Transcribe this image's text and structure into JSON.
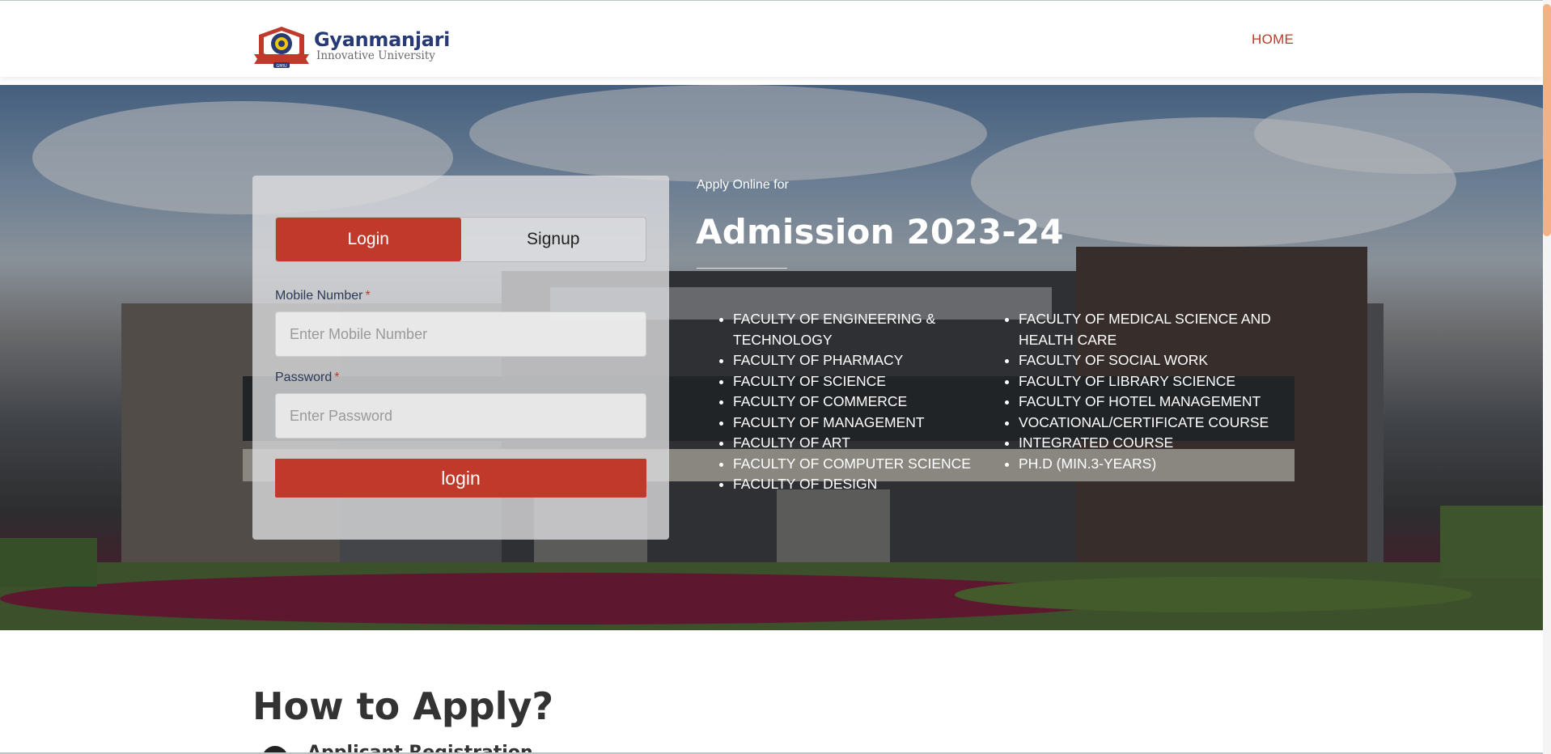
{
  "header": {
    "logo": {
      "title": "Gyanmanjari",
      "subtitle": "Innovative University",
      "emblem_text": "GMIU"
    },
    "nav": {
      "home": "HOME"
    },
    "accent": "#c0392b"
  },
  "login_card": {
    "tabs": [
      {
        "label": "Login",
        "active": true
      },
      {
        "label": "Signup",
        "active": false
      }
    ],
    "mobile": {
      "label": "Mobile Number",
      "required_mark": "*",
      "placeholder": "Enter Mobile Number",
      "value": ""
    },
    "password": {
      "label": "Password",
      "required_mark": "*",
      "placeholder": "Enter Password",
      "value": ""
    },
    "submit_label": "login"
  },
  "hero": {
    "apply_online": "Apply Online for",
    "admission_title": "Admission 2023-24",
    "faculties_left": [
      "FACULTY OF ENGINEERING & TECHNOLOGY",
      "FACULTY OF PHARMACY",
      "FACULTY OF SCIENCE",
      "FACULTY OF COMMERCE",
      "FACULTY OF MANAGEMENT",
      "FACULTY OF ART",
      "FACULTY OF COMPUTER SCIENCE",
      "FACULTY OF DESIGN"
    ],
    "faculties_right": [
      "FACULTY OF MEDICAL SCIENCE AND HEALTH CARE",
      "FACULTY OF SOCIAL WORK",
      "FACULTY OF LIBRARY SCIENCE",
      "FACULTY OF HOTEL MANAGEMENT",
      "VOCATIONAL/CERTIFICATE COURSE",
      "INTEGRATED COURSE",
      "PH.D (MIN.3-YEARS)"
    ]
  },
  "how_to_apply": {
    "title": "How to Apply?",
    "first_step": "Applicant Registration"
  }
}
